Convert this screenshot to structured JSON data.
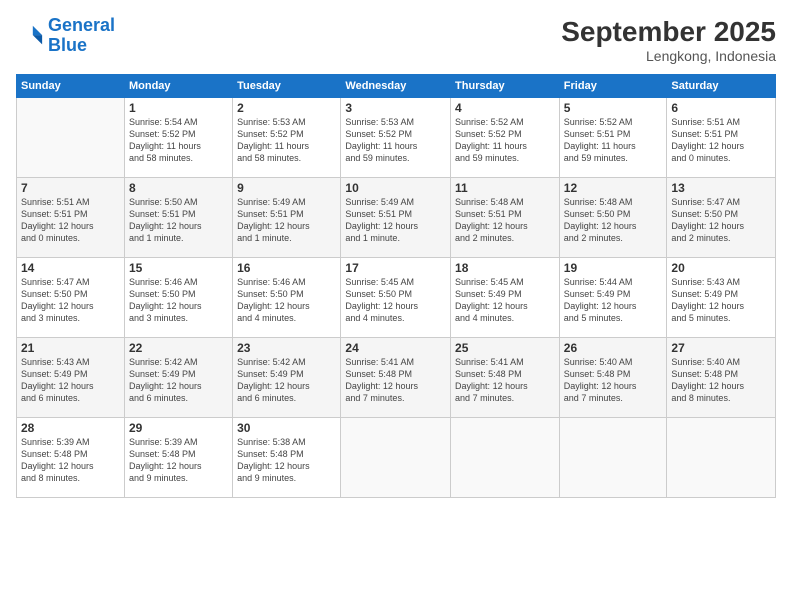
{
  "logo": {
    "line1": "General",
    "line2": "Blue"
  },
  "title": "September 2025",
  "location": "Lengkong, Indonesia",
  "days_header": [
    "Sunday",
    "Monday",
    "Tuesday",
    "Wednesday",
    "Thursday",
    "Friday",
    "Saturday"
  ],
  "weeks": [
    [
      {
        "num": "",
        "info": ""
      },
      {
        "num": "1",
        "info": "Sunrise: 5:54 AM\nSunset: 5:52 PM\nDaylight: 11 hours\nand 58 minutes."
      },
      {
        "num": "2",
        "info": "Sunrise: 5:53 AM\nSunset: 5:52 PM\nDaylight: 11 hours\nand 58 minutes."
      },
      {
        "num": "3",
        "info": "Sunrise: 5:53 AM\nSunset: 5:52 PM\nDaylight: 11 hours\nand 59 minutes."
      },
      {
        "num": "4",
        "info": "Sunrise: 5:52 AM\nSunset: 5:52 PM\nDaylight: 11 hours\nand 59 minutes."
      },
      {
        "num": "5",
        "info": "Sunrise: 5:52 AM\nSunset: 5:51 PM\nDaylight: 11 hours\nand 59 minutes."
      },
      {
        "num": "6",
        "info": "Sunrise: 5:51 AM\nSunset: 5:51 PM\nDaylight: 12 hours\nand 0 minutes."
      }
    ],
    [
      {
        "num": "7",
        "info": "Sunrise: 5:51 AM\nSunset: 5:51 PM\nDaylight: 12 hours\nand 0 minutes."
      },
      {
        "num": "8",
        "info": "Sunrise: 5:50 AM\nSunset: 5:51 PM\nDaylight: 12 hours\nand 1 minute."
      },
      {
        "num": "9",
        "info": "Sunrise: 5:49 AM\nSunset: 5:51 PM\nDaylight: 12 hours\nand 1 minute."
      },
      {
        "num": "10",
        "info": "Sunrise: 5:49 AM\nSunset: 5:51 PM\nDaylight: 12 hours\nand 1 minute."
      },
      {
        "num": "11",
        "info": "Sunrise: 5:48 AM\nSunset: 5:51 PM\nDaylight: 12 hours\nand 2 minutes."
      },
      {
        "num": "12",
        "info": "Sunrise: 5:48 AM\nSunset: 5:50 PM\nDaylight: 12 hours\nand 2 minutes."
      },
      {
        "num": "13",
        "info": "Sunrise: 5:47 AM\nSunset: 5:50 PM\nDaylight: 12 hours\nand 2 minutes."
      }
    ],
    [
      {
        "num": "14",
        "info": "Sunrise: 5:47 AM\nSunset: 5:50 PM\nDaylight: 12 hours\nand 3 minutes."
      },
      {
        "num": "15",
        "info": "Sunrise: 5:46 AM\nSunset: 5:50 PM\nDaylight: 12 hours\nand 3 minutes."
      },
      {
        "num": "16",
        "info": "Sunrise: 5:46 AM\nSunset: 5:50 PM\nDaylight: 12 hours\nand 4 minutes."
      },
      {
        "num": "17",
        "info": "Sunrise: 5:45 AM\nSunset: 5:50 PM\nDaylight: 12 hours\nand 4 minutes."
      },
      {
        "num": "18",
        "info": "Sunrise: 5:45 AM\nSunset: 5:49 PM\nDaylight: 12 hours\nand 4 minutes."
      },
      {
        "num": "19",
        "info": "Sunrise: 5:44 AM\nSunset: 5:49 PM\nDaylight: 12 hours\nand 5 minutes."
      },
      {
        "num": "20",
        "info": "Sunrise: 5:43 AM\nSunset: 5:49 PM\nDaylight: 12 hours\nand 5 minutes."
      }
    ],
    [
      {
        "num": "21",
        "info": "Sunrise: 5:43 AM\nSunset: 5:49 PM\nDaylight: 12 hours\nand 6 minutes."
      },
      {
        "num": "22",
        "info": "Sunrise: 5:42 AM\nSunset: 5:49 PM\nDaylight: 12 hours\nand 6 minutes."
      },
      {
        "num": "23",
        "info": "Sunrise: 5:42 AM\nSunset: 5:49 PM\nDaylight: 12 hours\nand 6 minutes."
      },
      {
        "num": "24",
        "info": "Sunrise: 5:41 AM\nSunset: 5:48 PM\nDaylight: 12 hours\nand 7 minutes."
      },
      {
        "num": "25",
        "info": "Sunrise: 5:41 AM\nSunset: 5:48 PM\nDaylight: 12 hours\nand 7 minutes."
      },
      {
        "num": "26",
        "info": "Sunrise: 5:40 AM\nSunset: 5:48 PM\nDaylight: 12 hours\nand 7 minutes."
      },
      {
        "num": "27",
        "info": "Sunrise: 5:40 AM\nSunset: 5:48 PM\nDaylight: 12 hours\nand 8 minutes."
      }
    ],
    [
      {
        "num": "28",
        "info": "Sunrise: 5:39 AM\nSunset: 5:48 PM\nDaylight: 12 hours\nand 8 minutes."
      },
      {
        "num": "29",
        "info": "Sunrise: 5:39 AM\nSunset: 5:48 PM\nDaylight: 12 hours\nand 9 minutes."
      },
      {
        "num": "30",
        "info": "Sunrise: 5:38 AM\nSunset: 5:48 PM\nDaylight: 12 hours\nand 9 minutes."
      },
      {
        "num": "",
        "info": ""
      },
      {
        "num": "",
        "info": ""
      },
      {
        "num": "",
        "info": ""
      },
      {
        "num": "",
        "info": ""
      }
    ]
  ]
}
